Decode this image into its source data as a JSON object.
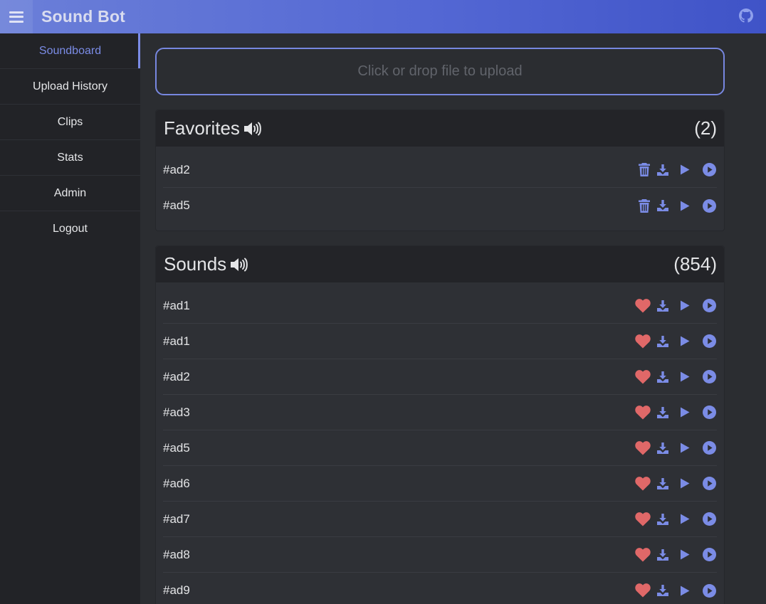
{
  "app": {
    "title": "Sound Bot"
  },
  "sidebar": {
    "items": [
      {
        "label": "Soundboard",
        "active": true
      },
      {
        "label": "Upload History"
      },
      {
        "label": "Clips"
      },
      {
        "label": "Stats"
      },
      {
        "label": "Admin"
      },
      {
        "label": "Logout"
      }
    ]
  },
  "upload": {
    "label": "Click or drop file to upload"
  },
  "favorites": {
    "title": "Favorites",
    "count": "(2)",
    "rows": [
      {
        "name": "#ad2"
      },
      {
        "name": "#ad5"
      }
    ]
  },
  "sounds": {
    "title": "Sounds",
    "count": "(854)",
    "rows": [
      {
        "name": "#ad1"
      },
      {
        "name": "#ad1"
      },
      {
        "name": "#ad2"
      },
      {
        "name": "#ad3"
      },
      {
        "name": "#ad5"
      },
      {
        "name": "#ad6"
      },
      {
        "name": "#ad7"
      },
      {
        "name": "#ad8"
      },
      {
        "name": "#ad9"
      }
    ]
  },
  "colors": {
    "accent": "#7787e0",
    "heart": "#e06868",
    "icon": "#7b8ce6"
  },
  "icons": {
    "menu": "hamburger-menu-icon",
    "github": "github-icon",
    "speaker": "speaker-icon",
    "favorite": "heart-icon",
    "remove_favorite": "trash-icon",
    "download": "download-icon",
    "play_local": "play-icon",
    "play_bot": "play-circle-icon"
  }
}
